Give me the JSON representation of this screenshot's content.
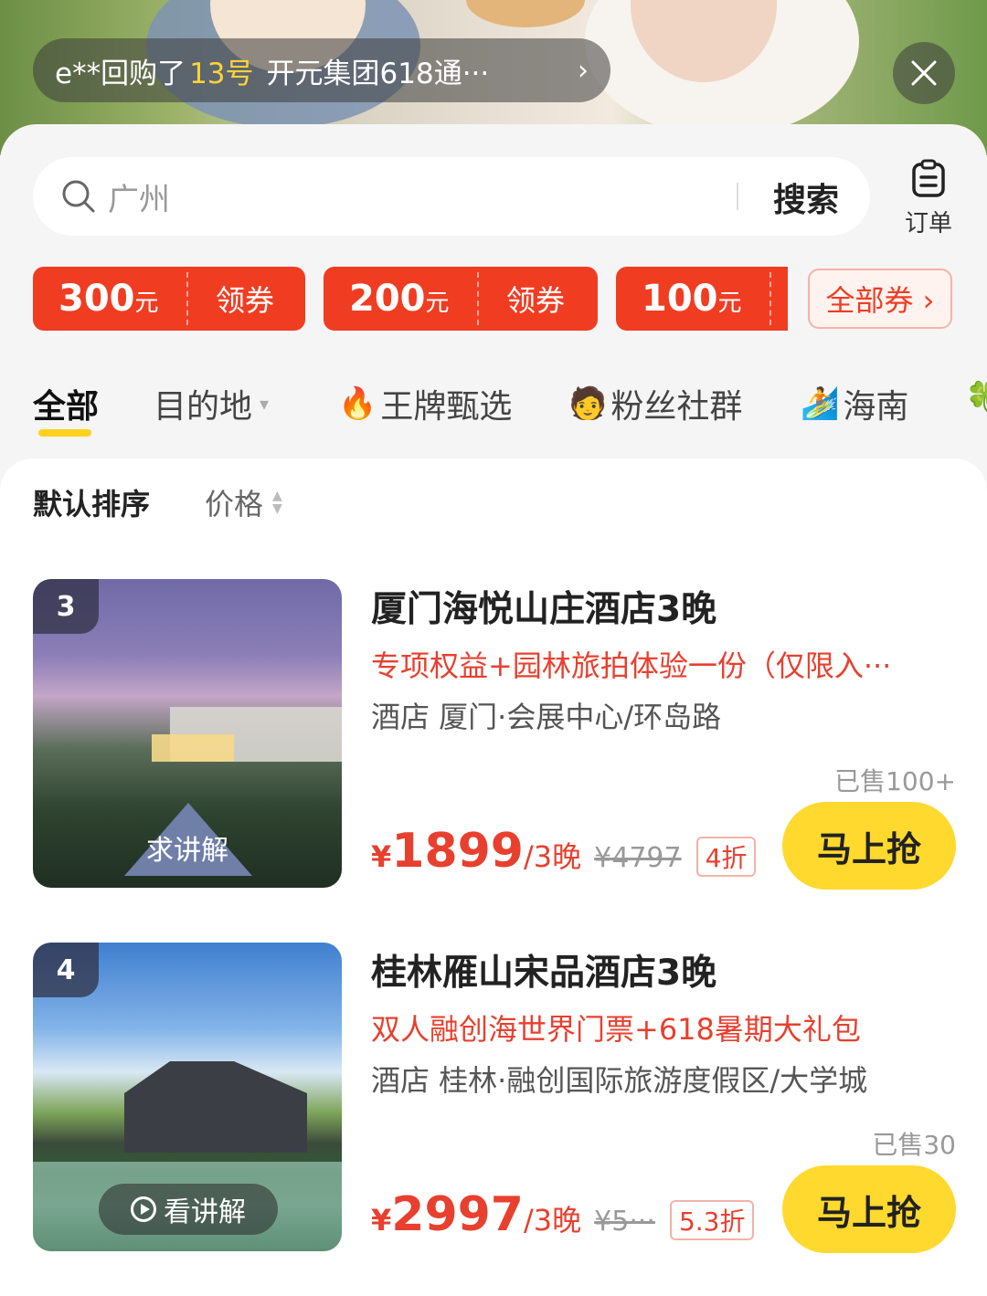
{
  "banner": {
    "ticker_user": "e**回购了",
    "ticker_number": "13号",
    "ticker_product": "开元集团618通···",
    "ticker_chevron": "›"
  },
  "search": {
    "placeholder": "广州",
    "button_label": "搜索"
  },
  "order": {
    "label": "订单"
  },
  "coupons": [
    {
      "amount": "300",
      "unit": "元",
      "action": "领券"
    },
    {
      "amount": "200",
      "unit": "元",
      "action": "领券"
    },
    {
      "amount": "100",
      "unit": "元",
      "action": ""
    }
  ],
  "coupon_all": "全部券 ›",
  "tabs": [
    {
      "label": "全部",
      "active": true
    },
    {
      "label": "目的地",
      "caret": "▾"
    },
    {
      "label": "王牌甄选",
      "emoji": "🔥"
    },
    {
      "label": "粉丝社群",
      "emoji": "🧑"
    },
    {
      "label": "海南",
      "emoji": "🏄"
    },
    {
      "label": "",
      "emoji": "🍀"
    }
  ],
  "sort": {
    "default": "默认排序",
    "price": "价格"
  },
  "items": [
    {
      "rank": "3",
      "thumb_label": "求讲解",
      "title": "厦门海悦山庄酒店3晚",
      "perk": "专项权益+园林旅拍体验一份（仅限入···",
      "location": "酒店 厦门·会展中心/环岛路",
      "sold": "已售100+",
      "yen": "¥",
      "price": "1899",
      "unit": "/3晚",
      "original": "¥4797",
      "discount": "4折",
      "cta": "马上抢"
    },
    {
      "rank": "4",
      "thumb_label": "看讲解",
      "title": "桂林雁山宋品酒店3晚",
      "perk": "双人融创海世界门票+618暑期大礼包",
      "location": "酒店 桂林·融创国际旅游度假区/大学城",
      "sold": "已售30",
      "yen": "¥",
      "price": "2997",
      "unit": "/3晚",
      "original": "¥5···",
      "discount": "5.3折",
      "cta": "马上抢"
    }
  ],
  "colors": {
    "accent_red": "#f03d22",
    "cta_yellow": "#ffd92e",
    "tab_underline": "#ffd21f"
  }
}
